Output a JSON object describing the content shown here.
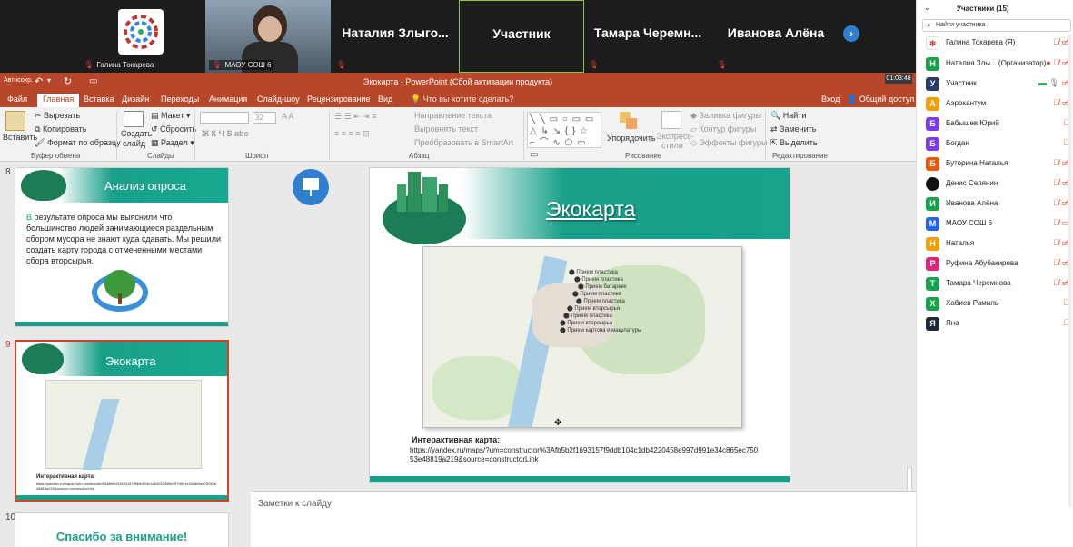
{
  "video": {
    "tiles": [
      {
        "name": "",
        "caption": "Галина Токарева"
      },
      {
        "name": "",
        "caption": "МАОУ СОШ 6"
      },
      {
        "name": "Наталия Злыго...",
        "caption": ""
      },
      {
        "name": "Участник",
        "caption": ""
      },
      {
        "name": "Тамара Черемн...",
        "caption": ""
      },
      {
        "name": "Иванова Алёна",
        "caption": ""
      }
    ],
    "next_icon": "chevron-right-icon",
    "timer": "01:03:48"
  },
  "ppt": {
    "autosave": "Автосохр.",
    "title": "Экокарта - PowerPoint (Сбой активации продукта)",
    "tabs": [
      "Файл",
      "Главная",
      "Вставка",
      "Дизайн",
      "Переходы",
      "Анимация",
      "Слайд-шоу",
      "Рецензирование",
      "Вид"
    ],
    "tell_me": "Что вы хотите сделать?",
    "login": "Вход",
    "share": "Общий доступ",
    "ribbon": {
      "paste": "Вставить",
      "cut": "Вырезать",
      "copy": "Копировать",
      "format_painter": "Формат по образцу",
      "clipboard": "Буфер обмена",
      "new_slide_1": "Создать",
      "new_slide_2": "слайд",
      "layout": "Макет",
      "reset": "Сбросить",
      "section": "Раздел",
      "slides": "Слайды",
      "font_size": "32",
      "font_style_buttons": "Ж  К  Ч  S  abc",
      "font": "Шрифт",
      "text_direction": "Направление текста",
      "align_text": "Выровнять текст",
      "smartart": "Преобразовать в SmartArt",
      "paragraph": "Абзац",
      "arrange": "Упорядочить",
      "quick_styles_1": "Экспресс-",
      "quick_styles_2": "стили",
      "shape_fill": "Заливка фигуры",
      "shape_outline": "Контур фигуры",
      "shape_effects": "Эффекты фигуры",
      "drawing": "Рисование",
      "find": "Найти",
      "replace": "Заменить",
      "select": "Выделить",
      "editing": "Редактирование"
    },
    "thumbs": [
      {
        "num": "8",
        "title": "Анализ опроса",
        "text_lead": "В",
        "text": " результате опроса мы выяснили что большинство людей занимающиеся раздельным сбором мусора не знают куда сдавать. Мы решили создать карту города с отмеченными местами сбора вторсырья."
      },
      {
        "num": "9",
        "title": "Экокарта",
        "caption": "Интерактивная карта:",
        "link": "https://yandex.ru/maps/?um=constructor%3Afb5b2f1693157f9ddb104c1db4220458e997d991e34c865ec75053e48819a219&source=constructorLink"
      },
      {
        "num": "10",
        "title": "Спасибо за внимание!"
      }
    ],
    "slide": {
      "title": "Экокарта",
      "map_labels": [
        "Прием пластика",
        "Прием пластика",
        "Прием батареек",
        "Прием пластика",
        "Прием пластика",
        "Прием вторсырья",
        "Прием картона и макулатуры",
        "Прием пластика",
        "Прием вторсырья"
      ],
      "caption": "Интерактивная карта:",
      "link_line1": "https://yandex.ru/maps/?um=constructor%3Afb5b2f1693157f9ddb104c1db4220458e997d991e34c865ec750",
      "link_line2": "53e48819a219&source=constructorLink"
    },
    "notes": "Заметки к слайду"
  },
  "panel": {
    "header": "Участники (15)",
    "search_placeholder": "Найти участника",
    "participants": [
      {
        "initial": "",
        "name": "Галина Токарева (Я)",
        "color": "#ffffff"
      },
      {
        "initial": "Н",
        "name": "Наталия Злы...  (Организатор)",
        "color": "#16a34a"
      },
      {
        "initial": "У",
        "name": "Участник",
        "color": "#2b3a67"
      },
      {
        "initial": "А",
        "name": "Аэрокантум",
        "color": "#f59e0b"
      },
      {
        "initial": "Б",
        "name": "Бабышев Юрий",
        "color": "#7c3aed"
      },
      {
        "initial": "Б",
        "name": "Богдан",
        "color": "#7c3aed"
      },
      {
        "initial": "Б",
        "name": "Буторина Наталья",
        "color": "#ea580c"
      },
      {
        "initial": "",
        "name": "Денис Селянин",
        "color": "#111111"
      },
      {
        "initial": "И",
        "name": "Иванова Алёна",
        "color": "#16a34a"
      },
      {
        "initial": "М",
        "name": "МАОУ СОШ 6",
        "color": "#2563eb"
      },
      {
        "initial": "Н",
        "name": "Наталья",
        "color": "#f59e0b"
      },
      {
        "initial": "Р",
        "name": "Руфина Абубакирова",
        "color": "#db2777"
      },
      {
        "initial": "Т",
        "name": "Тамара Черемнова",
        "color": "#16a34a"
      },
      {
        "initial": "Х",
        "name": "Хабиев Рамиль",
        "color": "#16a34a"
      },
      {
        "initial": "Я",
        "name": "Яна",
        "color": "#1f2937"
      }
    ]
  },
  "colors": {
    "ppt_red": "#b7472a",
    "teal": "#1aa08a",
    "accent_blue": "#2e7fd1"
  }
}
